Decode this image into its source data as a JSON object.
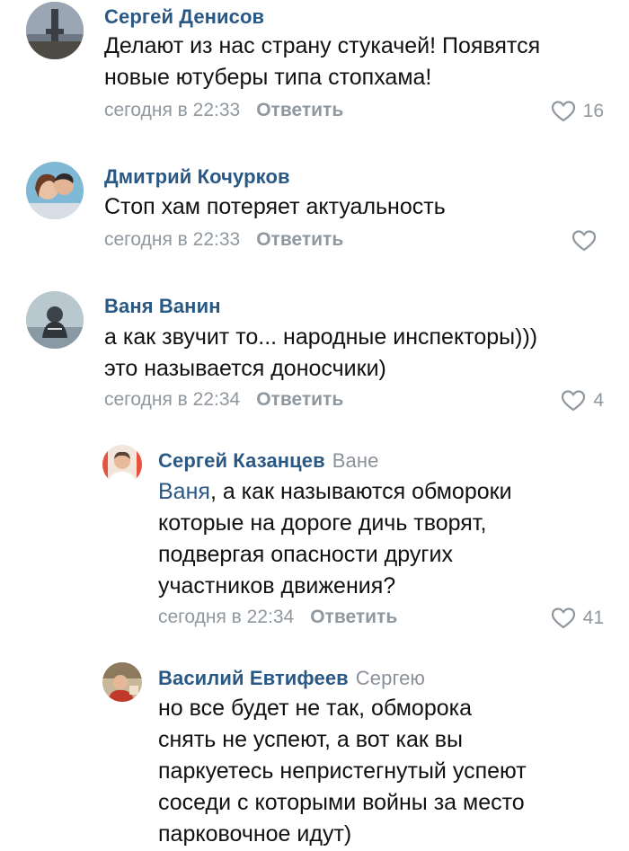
{
  "comments": [
    {
      "author": "Сергей Денисов",
      "reply_to": "",
      "mention": "",
      "lines": [
        "Делают из нас страну стукачей! Появятся",
        "новые ютуберы типа стопхама!"
      ],
      "time": "сегодня в 22:33",
      "reply_label": "Ответить",
      "likes": "16"
    },
    {
      "author": "Дмитрий Кочурков",
      "reply_to": "",
      "mention": "",
      "lines": [
        "Стоп хам потеряет актуальность"
      ],
      "time": "сегодня в 22:33",
      "reply_label": "Ответить",
      "likes": ""
    },
    {
      "author": "Ваня Ванин",
      "reply_to": "",
      "mention": "",
      "lines": [
        "а как звучит то... народные инспекторы)))",
        "это называется доносчики)"
      ],
      "time": "сегодня в 22:34",
      "reply_label": "Ответить",
      "likes": "4"
    },
    {
      "author": "Сергей Казанцев",
      "reply_to": "Ване",
      "mention": "Ваня",
      "lines": [
        ", а как называются обмороки",
        "которые на дороге дичь творят,",
        "подвергая опасности других",
        "участников движения?"
      ],
      "time": "сегодня в 22:34",
      "reply_label": "Ответить",
      "likes": "41"
    },
    {
      "author": "Василий Евтифеев",
      "reply_to": "Сергею",
      "mention": "",
      "lines": [
        "но все будет не так, обморока",
        "снять не успеют, а вот как вы",
        "паркуетесь непристегнутый успеют",
        "соседи с которыми войны за место",
        "парковочное идут)"
      ],
      "time": "",
      "reply_label": "",
      "likes": ""
    }
  ],
  "colors": {
    "link": "#2a5885",
    "meta": "#8f979f",
    "text": "#111111"
  },
  "icons": {
    "like": "heart-outline-icon"
  }
}
